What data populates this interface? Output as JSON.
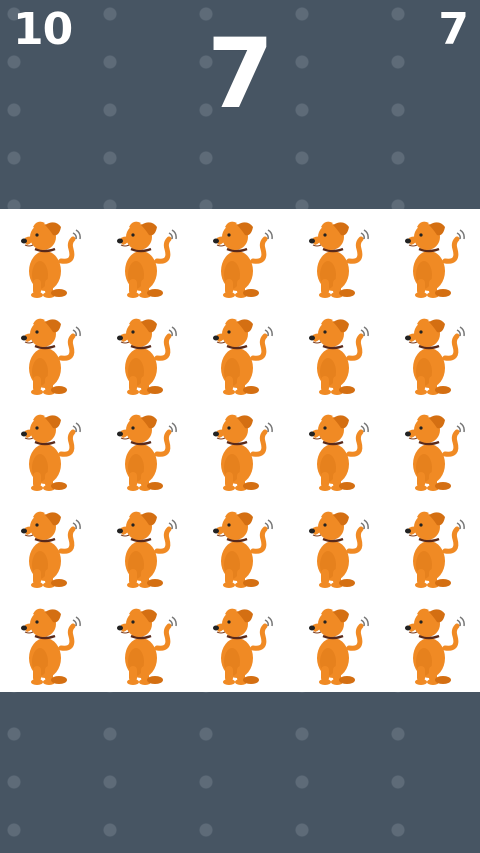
{
  "hud": {
    "left_value": "10",
    "center_value": "7",
    "right_value": "7"
  },
  "board": {
    "rows": 5,
    "columns": 5,
    "tile_icon": "orange-dog-icon",
    "colors": {
      "dog_body": "#F08A24",
      "dog_shade": "#D46F12",
      "collar": "#5A2A1A",
      "background": "#475563",
      "board": "#FFFFFF"
    }
  }
}
